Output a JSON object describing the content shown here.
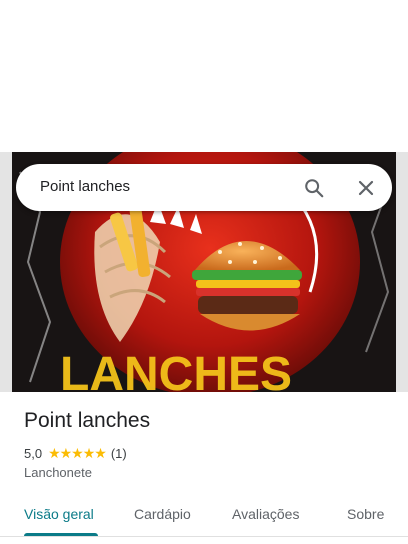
{
  "search": {
    "query": "Point lanches",
    "search_icon": "search-icon",
    "close_icon": "close-icon"
  },
  "place": {
    "name": "Point lanches",
    "rating": "5,0",
    "stars": "★★★★★",
    "rating_value": 5.0,
    "review_count": "(1)",
    "category": "Lanchonete"
  },
  "tabs": [
    {
      "label": "Visão geral",
      "active": true
    },
    {
      "label": "Cardápio",
      "active": false
    },
    {
      "label": "Avaliações",
      "active": false
    },
    {
      "label": "Sobre",
      "active": false
    }
  ],
  "colors": {
    "accent": "#0b7b88",
    "star": "#fbbc04"
  }
}
